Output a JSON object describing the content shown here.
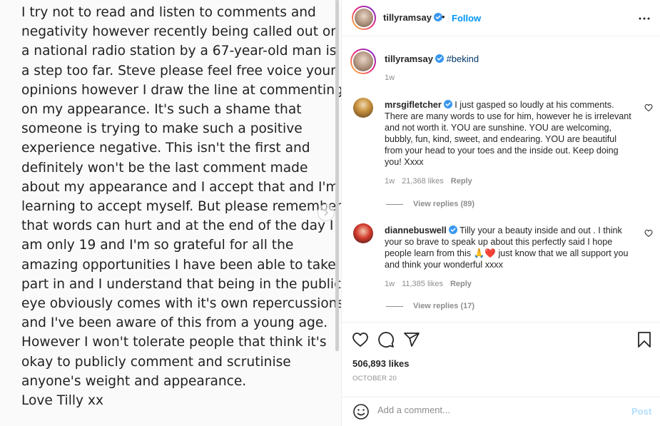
{
  "post_image": {
    "lines": [
      "I try not to read and listen to comments and",
      "negativity however recently being called out on",
      "a national radio station by a 67-year-old man is",
      "a step too far. Steve please feel free voice your",
      "opinions however I draw the line at commenting",
      "on my appearance. It's such a shame that",
      "someone is trying to make such a positive",
      "experience negative. This isn't the first and",
      "definitely won't be the last comment made",
      "about my appearance and I accept that and I'm",
      "learning to accept myself. But please remember",
      "that words can hurt and at the end of the day I",
      "am only 19 and I'm so grateful for all the",
      "amazing opportunities I have been able to take",
      "part in and I understand that being in the public",
      "eye obviously comes with it's own repercussions",
      "and I've been aware of this from a young age.",
      "However I won't tolerate people that think it's",
      "okay to publicly comment and scrutinise",
      "anyone's weight and appearance.",
      "Love Tilly xx"
    ]
  },
  "header": {
    "username": "tillyramsay",
    "separator": "•",
    "follow_label": "Follow",
    "more_icon": "more-horizontal-icon"
  },
  "caption": {
    "username": "tillyramsay",
    "hashtag": "#bekind",
    "time": "1w"
  },
  "comments": [
    {
      "username": "mrsgifletcher",
      "text": "I just gasped so loudly at his comments. There are many words to use for him, however he is irrelevant and not worth it. YOU are sunshine. YOU are welcoming, bubbly, fun, kind, sweet, and endearing. YOU are beautiful from your head to your toes and the inside out. Keep doing you! Xxxx",
      "time": "1w",
      "likes": "21,368 likes",
      "reply_label": "Reply",
      "view_replies": "View replies (89)"
    },
    {
      "username": "dianneb​uswell",
      "text_before": "Tilly your a beauty inside and out . I think your so brave to speak up about this perfectly said I hope people learn from this",
      "emoji": "🙏❤️",
      "text_after": "just know that we all support you and think your wonderful xxxx",
      "time": "1w",
      "likes": "11,385 likes",
      "reply_label": "Reply",
      "view_replies": "View replies (17)"
    }
  ],
  "actions": {
    "likes": "506,893 likes",
    "date": "OCTOBER 20",
    "comment_placeholder": "Add a comment...",
    "post_label": "Post"
  },
  "colors": {
    "accent": "#0095f6",
    "verified": "#3897f0",
    "muted": "#8e8e8e",
    "post_disabled": "#b2dffc"
  }
}
